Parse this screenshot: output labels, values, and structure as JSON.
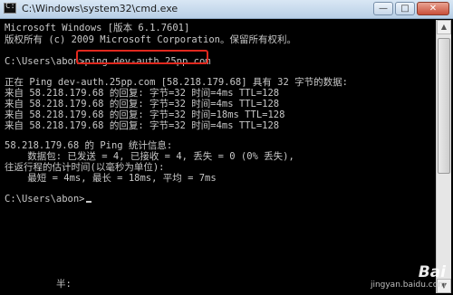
{
  "window": {
    "title": "C:\\Windows\\system32\\cmd.exe",
    "icon": "cmd-icon",
    "controls": {
      "minimize": "—",
      "maximize": "□",
      "close": "✕"
    }
  },
  "console": {
    "lines": [
      "Microsoft Windows [版本 6.1.7601]",
      "版权所有 (c) 2009 Microsoft Corporation。保留所有权利。",
      "",
      "C:\\Users\\abon>",
      "",
      "正在 Ping dev-auth.25pp.com [58.218.179.68] 具有 32 字节的数据:",
      "来自 58.218.179.68 的回复: 字节=32 时间=4ms TTL=128",
      "来自 58.218.179.68 的回复: 字节=32 时间=4ms TTL=128",
      "来自 58.218.179.68 的回复: 字节=32 时间=18ms TTL=128",
      "来自 58.218.179.68 的回复: 字节=32 时间=4ms TTL=128",
      "",
      "58.218.179.68 的 Ping 统计信息:",
      "    数据包: 已发送 = 4, 已接收 = 4, 丢失 = 0 (0% 丢失),",
      "往返行程的估计时间(以毫秒为单位):",
      "    最短 = 4ms, 最长 = 18ms, 平均 = 7ms",
      "",
      "C:\\Users\\abon>"
    ],
    "command": "ping dev-auth.25pp.com",
    "highlight_color": "#e0281e",
    "bottom_fragment": "半:"
  },
  "watermark": {
    "text": "jingyan.baidu.com",
    "brand": "Bai"
  }
}
